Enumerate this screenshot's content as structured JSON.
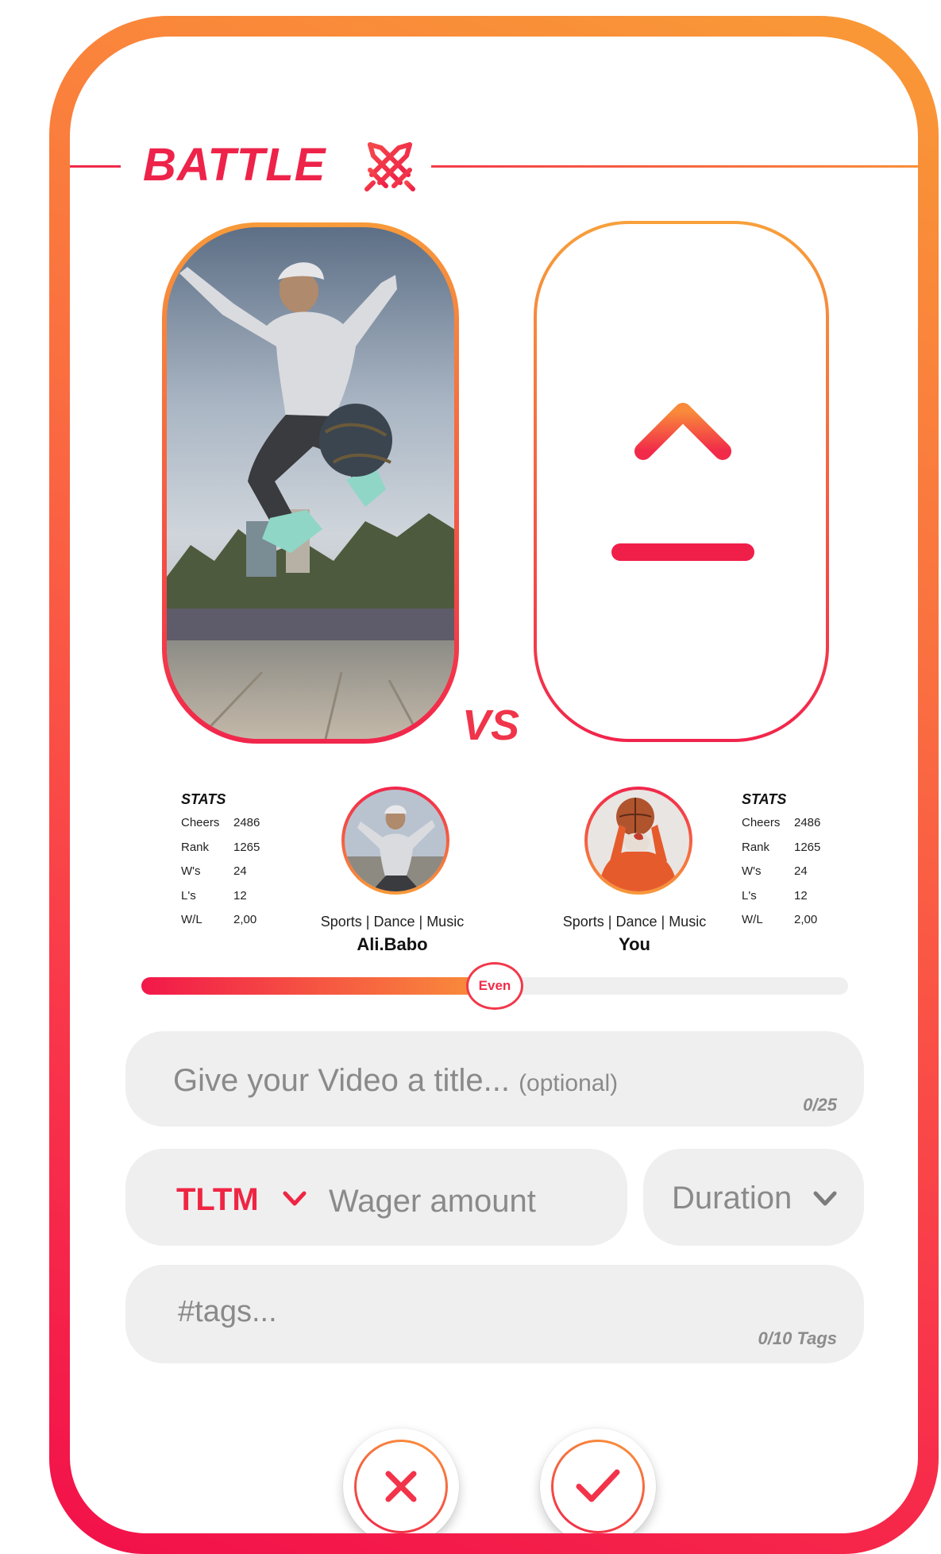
{
  "header": {
    "title": "BATTLE",
    "icon": "crossed-swords-icon"
  },
  "vs_label": "VS",
  "left_player": {
    "stats_title": "STATS",
    "stats": [
      {
        "label": "Cheers",
        "value": "2486"
      },
      {
        "label": "Rank",
        "value": "1265"
      },
      {
        "label": "W's",
        "value": "24"
      },
      {
        "label": "L's",
        "value": "12"
      },
      {
        "label": "W/L",
        "value": "2,00"
      }
    ],
    "genres": "Sports | Dance | Music",
    "name": "Ali.Babo"
  },
  "right_player": {
    "stats_title": "STATS",
    "stats": [
      {
        "label": "Cheers",
        "value": "2486"
      },
      {
        "label": "Rank",
        "value": "1265"
      },
      {
        "label": "W's",
        "value": "24"
      },
      {
        "label": "L's",
        "value": "12"
      },
      {
        "label": "W/L",
        "value": "2,00"
      }
    ],
    "genres": "Sports | Dance | Music",
    "name": "You"
  },
  "balance_slider": {
    "label": "Even",
    "fraction": 0.5
  },
  "title_input": {
    "placeholder": "Give your Video a title...",
    "optional_hint": "(optional)",
    "counter": "0/25"
  },
  "wager": {
    "currency": "TLTM",
    "placeholder": "Wager amount"
  },
  "duration": {
    "label": "Duration"
  },
  "tags_input": {
    "placeholder": "#tags...",
    "counter": "0/10 Tags"
  },
  "actions": {
    "cancel_icon": "close-icon",
    "confirm_icon": "check-icon"
  },
  "colors": {
    "accent_red": "#ef2349",
    "accent_orange": "#f99a36",
    "field_bg": "#efefef"
  }
}
